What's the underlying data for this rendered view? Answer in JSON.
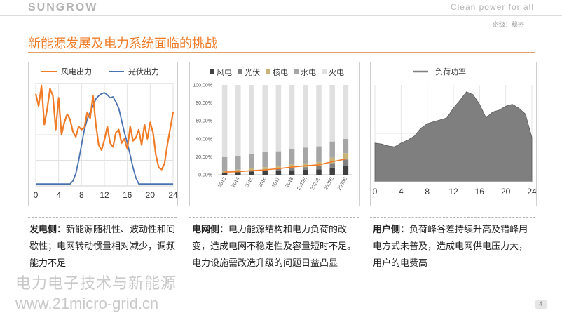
{
  "header": {
    "logo": "SUNGROW",
    "tagline": "Clean power for all",
    "secret": "密级：秘密"
  },
  "page": {
    "title": "新能源发展及电力系统面临的挑战",
    "number": "4"
  },
  "panels": [
    {
      "desc_head": "发电侧：",
      "desc_body": "新能源随机性、波动性和间歇性；电网转动惯量相对减少，调频能力不足"
    },
    {
      "desc_head": "电网侧：",
      "desc_body": "电力能源结构和电力负荷的改变，造成电网不稳定性及容量短时不足。电力设施需改造升级的问题日益凸显"
    },
    {
      "desc_head": "用户侧：",
      "desc_body": "负荷峰谷差持续升高及错峰用电方式未普及，造成电网供电压力大，用户的电费高"
    }
  ],
  "watermark": {
    "line1": "电力电子技术与新能源",
    "line2": "www.21micro-grid.cn"
  },
  "colors": {
    "accent": "#f07c28",
    "wind": "#f07c28",
    "solar": "#4a72b0"
  },
  "chart_data": [
    {
      "type": "line",
      "title": "",
      "x_ticks": [
        0,
        4,
        8,
        12,
        16,
        20,
        24
      ],
      "xlim": [
        0,
        24
      ],
      "ylim": [
        0,
        1
      ],
      "grid": true,
      "legend_position": "top",
      "series": [
        {
          "name": "风电出力",
          "color": "#f07c28",
          "x": [
            0,
            0.5,
            1,
            1.5,
            2,
            2.5,
            3,
            3.5,
            4,
            4.5,
            5,
            5.5,
            6,
            6.5,
            7,
            7.5,
            8,
            8.5,
            9,
            9.5,
            10,
            10.5,
            11,
            11.5,
            12,
            12.5,
            13,
            13.5,
            14,
            14.5,
            15,
            15.5,
            16,
            16.5,
            17,
            17.5,
            18,
            18.5,
            19,
            19.5,
            20,
            20.5,
            21,
            21.5,
            22,
            22.5,
            23,
            23.5,
            24
          ],
          "y": [
            0.9,
            0.78,
            0.98,
            0.6,
            0.75,
            0.95,
            0.88,
            0.55,
            0.86,
            0.5,
            0.62,
            0.7,
            0.65,
            0.53,
            0.48,
            0.58,
            0.55,
            0.57,
            0.72,
            0.66,
            0.88,
            0.6,
            0.4,
            0.35,
            0.45,
            0.58,
            0.42,
            0.38,
            0.52,
            0.55,
            0.42,
            0.46,
            0.36,
            0.58,
            0.44,
            0.47,
            0.55,
            0.4,
            0.6,
            0.46,
            0.62,
            0.52,
            0.3,
            0.18,
            0.16,
            0.22,
            0.4,
            0.56,
            0.72
          ]
        },
        {
          "name": "光伏出力",
          "color": "#4a72b0",
          "x": [
            0,
            6,
            6.5,
            7,
            7.5,
            8,
            8.5,
            9,
            9.5,
            10,
            10.5,
            11,
            11.5,
            12,
            12.5,
            13,
            13.5,
            14,
            14.5,
            15,
            15.5,
            16,
            16.5,
            17,
            17.5,
            18,
            24
          ],
          "y": [
            0.02,
            0.02,
            0.05,
            0.12,
            0.25,
            0.4,
            0.55,
            0.65,
            0.72,
            0.78,
            0.85,
            0.88,
            0.9,
            0.91,
            0.89,
            0.86,
            0.87,
            0.82,
            0.76,
            0.64,
            0.52,
            0.42,
            0.3,
            0.18,
            0.08,
            0.02,
            0.02
          ]
        }
      ]
    },
    {
      "type": "bar",
      "title": "",
      "categories": [
        "2013",
        "2014",
        "2015",
        "2016",
        "2017",
        "2018",
        "2019E",
        "2020E",
        "2025E",
        "2030E"
      ],
      "y_ticks": [
        "0.00%",
        "20.00%",
        "40.00%",
        "60.00%",
        "80.00%",
        "100.00%"
      ],
      "ylim": [
        0,
        100
      ],
      "legend_position": "top",
      "stacked": true,
      "series": [
        {
          "name": "风电",
          "color": "#404040",
          "values": [
            2.5,
            3,
            3.5,
            4,
            4.5,
            5,
            5.5,
            6,
            8,
            10
          ]
        },
        {
          "name": "光伏",
          "color": "#808080",
          "values": [
            0.2,
            0.4,
            0.8,
            1.2,
            2,
            2.5,
            3,
            3.5,
            5,
            7
          ]
        },
        {
          "name": "核电",
          "color": "#c8b478",
          "values": [
            2,
            2.3,
            2.8,
            3.3,
            3.6,
            4,
            4.3,
            4.6,
            6,
            7
          ]
        },
        {
          "name": "水电",
          "color": "#a6a6a6",
          "values": [
            15,
            15.5,
            16,
            16.5,
            16,
            17,
            17.5,
            17.5,
            18,
            16
          ]
        },
        {
          "name": "火电",
          "color": "#e0e0e0",
          "values": [
            80.3,
            78.8,
            76.9,
            75,
            73.9,
            71.5,
            69.7,
            68.4,
            63,
            60
          ]
        }
      ],
      "line": {
        "name": "",
        "color": "#f07c28",
        "values": [
          3.0,
          3.4,
          4.5,
          5.5,
          6.8,
          8.5,
          10.0,
          11.0,
          14.5,
          17.5
        ]
      }
    },
    {
      "type": "area",
      "title": "",
      "x_ticks": [
        0,
        4,
        8,
        12,
        16,
        20,
        24
      ],
      "xlim": [
        0,
        24
      ],
      "ylim": [
        0,
        1
      ],
      "grid": true,
      "legend_position": "top",
      "series": [
        {
          "name": "负荷功率",
          "color": "#7f7f7f",
          "x": [
            0,
            1,
            2,
            3,
            4,
            5,
            6,
            7,
            8,
            9,
            10,
            11,
            12,
            13,
            14,
            15,
            16,
            17,
            18,
            19,
            20,
            21,
            22,
            23,
            24
          ],
          "y": [
            0.4,
            0.39,
            0.37,
            0.36,
            0.4,
            0.43,
            0.47,
            0.55,
            0.6,
            0.62,
            0.64,
            0.66,
            0.76,
            0.84,
            0.93,
            0.9,
            0.8,
            0.66,
            0.72,
            0.74,
            0.78,
            0.8,
            0.76,
            0.7,
            0.46
          ]
        }
      ]
    }
  ]
}
